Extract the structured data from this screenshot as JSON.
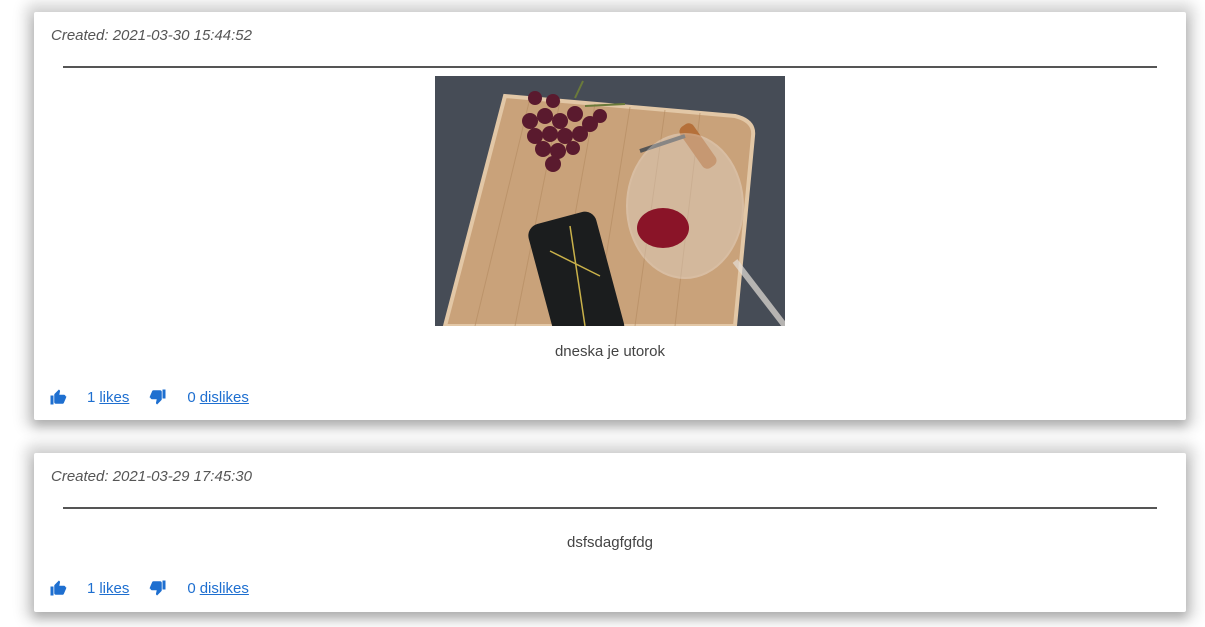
{
  "posts": [
    {
      "created": "Created: 2021-03-30 15:44:52",
      "text": "dneska je utorok",
      "likes_count": "1",
      "likes_label": "likes",
      "dislikes_count": "0",
      "dislikes_label": "dislikes",
      "image_alt": "wine photo"
    },
    {
      "created": "Created: 2021-03-29 17:45:30",
      "text": "dsfsdagfgfdg",
      "likes_count": "1",
      "likes_label": "likes",
      "dislikes_count": "0",
      "dislikes_label": "dislikes"
    }
  ],
  "icons": {
    "like": "thumbs-up-icon",
    "dislike": "thumbs-down-icon"
  },
  "colors": {
    "accent": "#1e6fd0",
    "divider": "#555555"
  }
}
